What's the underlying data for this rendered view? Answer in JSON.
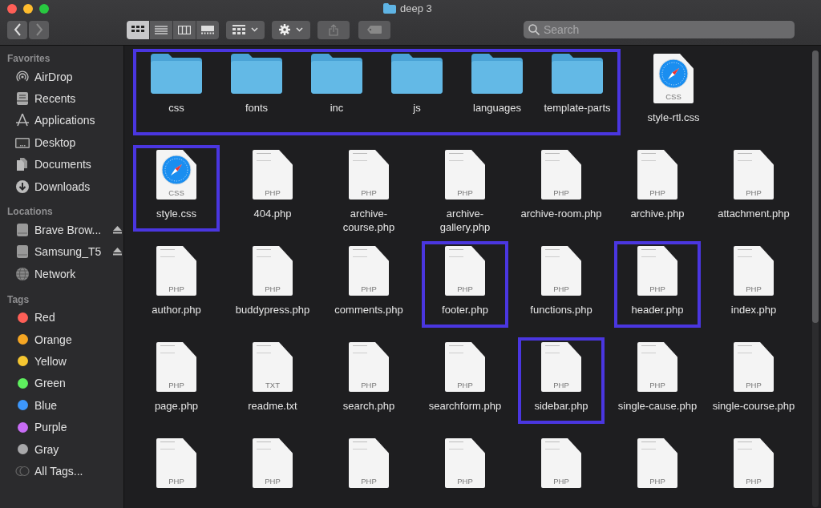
{
  "window": {
    "title": "deep 3"
  },
  "toolbar": {
    "view_modes": [
      {
        "selected": true
      },
      {
        "selected": false
      },
      {
        "selected": false
      },
      {
        "selected": false
      }
    ],
    "search": {
      "placeholder": "Search"
    }
  },
  "sidebar": {
    "sections": [
      {
        "title": "Favorites",
        "items": [
          {
            "label": "AirDrop",
            "kind": "airdrop"
          },
          {
            "label": "Recents",
            "kind": "recents"
          },
          {
            "label": "Applications",
            "kind": "applications"
          },
          {
            "label": "Desktop",
            "kind": "desktop"
          },
          {
            "label": "Documents",
            "kind": "documents"
          },
          {
            "label": "Downloads",
            "kind": "downloads"
          }
        ]
      },
      {
        "title": "Locations",
        "items": [
          {
            "label": "Brave Brow...",
            "kind": "drive",
            "eject": true
          },
          {
            "label": "Samsung_T5",
            "kind": "drive",
            "eject": true
          },
          {
            "label": "Network",
            "kind": "network"
          }
        ]
      },
      {
        "title": "Tags",
        "items": [
          {
            "label": "Red",
            "kind": "tag",
            "color": "#fe5f57"
          },
          {
            "label": "Orange",
            "kind": "tag",
            "color": "#f5a623"
          },
          {
            "label": "Yellow",
            "kind": "tag",
            "color": "#f5c631"
          },
          {
            "label": "Green",
            "kind": "tag",
            "color": "#5ef05e"
          },
          {
            "label": "Blue",
            "kind": "tag",
            "color": "#3d97fb"
          },
          {
            "label": "Purple",
            "kind": "tag",
            "color": "#c86cf5"
          },
          {
            "label": "Gray",
            "kind": "tag",
            "color": "#a8a8aa"
          },
          {
            "label": "All Tags...",
            "kind": "all-tags"
          }
        ]
      }
    ]
  },
  "files": {
    "rows": [
      {
        "items": [
          {
            "name": "css",
            "kind": "folder",
            "highlighted": true
          },
          {
            "name": "fonts",
            "kind": "folder",
            "highlighted": true
          },
          {
            "name": "inc",
            "kind": "folder",
            "highlighted": true
          },
          {
            "name": "js",
            "kind": "folder",
            "highlighted": true
          },
          {
            "name": "languages",
            "kind": "folder",
            "highlighted": true
          },
          {
            "name": "template-parts",
            "kind": "folder",
            "highlighted": true
          },
          {
            "name": "style-rtl.css",
            "kind": "stylesheet",
            "badge": "CSS",
            "highlighted": false
          }
        ]
      },
      {
        "items": [
          {
            "name": "style.css",
            "kind": "stylesheet",
            "badge": "CSS",
            "highlighted": true
          },
          {
            "name": "404.php",
            "kind": "script",
            "badge": "PHP",
            "highlighted": false
          },
          {
            "name": "archive-\ncourse.php",
            "kind": "script",
            "badge": "PHP",
            "highlighted": false
          },
          {
            "name": "archive-\ngallery.php",
            "kind": "script",
            "badge": "PHP",
            "highlighted": false
          },
          {
            "name": "archive-room.php",
            "kind": "script",
            "badge": "PHP",
            "highlighted": false
          },
          {
            "name": "archive.php",
            "kind": "script",
            "badge": "PHP",
            "highlighted": false
          },
          {
            "name": "attachment.php",
            "kind": "script",
            "badge": "PHP",
            "highlighted": false
          }
        ]
      },
      {
        "items": [
          {
            "name": "author.php",
            "kind": "script",
            "badge": "PHP",
            "highlighted": false
          },
          {
            "name": "buddypress.php",
            "kind": "script",
            "badge": "PHP",
            "highlighted": false
          },
          {
            "name": "comments.php",
            "kind": "script",
            "badge": "PHP",
            "highlighted": false
          },
          {
            "name": "footer.php",
            "kind": "script",
            "badge": "PHP",
            "highlighted": true
          },
          {
            "name": "functions.php",
            "kind": "script",
            "badge": "PHP",
            "highlighted": false
          },
          {
            "name": "header.php",
            "kind": "script",
            "badge": "PHP",
            "highlighted": true
          },
          {
            "name": "index.php",
            "kind": "script",
            "badge": "PHP",
            "highlighted": false
          }
        ]
      },
      {
        "items": [
          {
            "name": "page.php",
            "kind": "script",
            "badge": "PHP",
            "highlighted": false
          },
          {
            "name": "readme.txt",
            "kind": "script",
            "badge": "TXT",
            "highlighted": false
          },
          {
            "name": "search.php",
            "kind": "script",
            "badge": "PHP",
            "highlighted": false
          },
          {
            "name": "searchform.php",
            "kind": "script",
            "badge": "PHP",
            "highlighted": false
          },
          {
            "name": "sidebar.php",
            "kind": "script",
            "badge": "PHP",
            "highlighted": true
          },
          {
            "name": "single-cause.php",
            "kind": "script",
            "badge": "PHP",
            "highlighted": false
          },
          {
            "name": "single-course.php",
            "kind": "script",
            "badge": "PHP",
            "highlighted": false
          }
        ]
      },
      {
        "items": [
          {
            "kind": "script",
            "badge": "PHP",
            "highlighted": false
          },
          {
            "kind": "script",
            "badge": "PHP",
            "highlighted": false
          },
          {
            "kind": "script",
            "badge": "PHP",
            "highlighted": false
          },
          {
            "kind": "script",
            "badge": "PHP",
            "highlighted": false
          },
          {
            "kind": "script",
            "badge": "PHP",
            "highlighted": false
          },
          {
            "kind": "script",
            "badge": "PHP",
            "highlighted": false
          },
          {
            "kind": "script",
            "badge": "PHP",
            "highlighted": false
          }
        ]
      }
    ]
  }
}
